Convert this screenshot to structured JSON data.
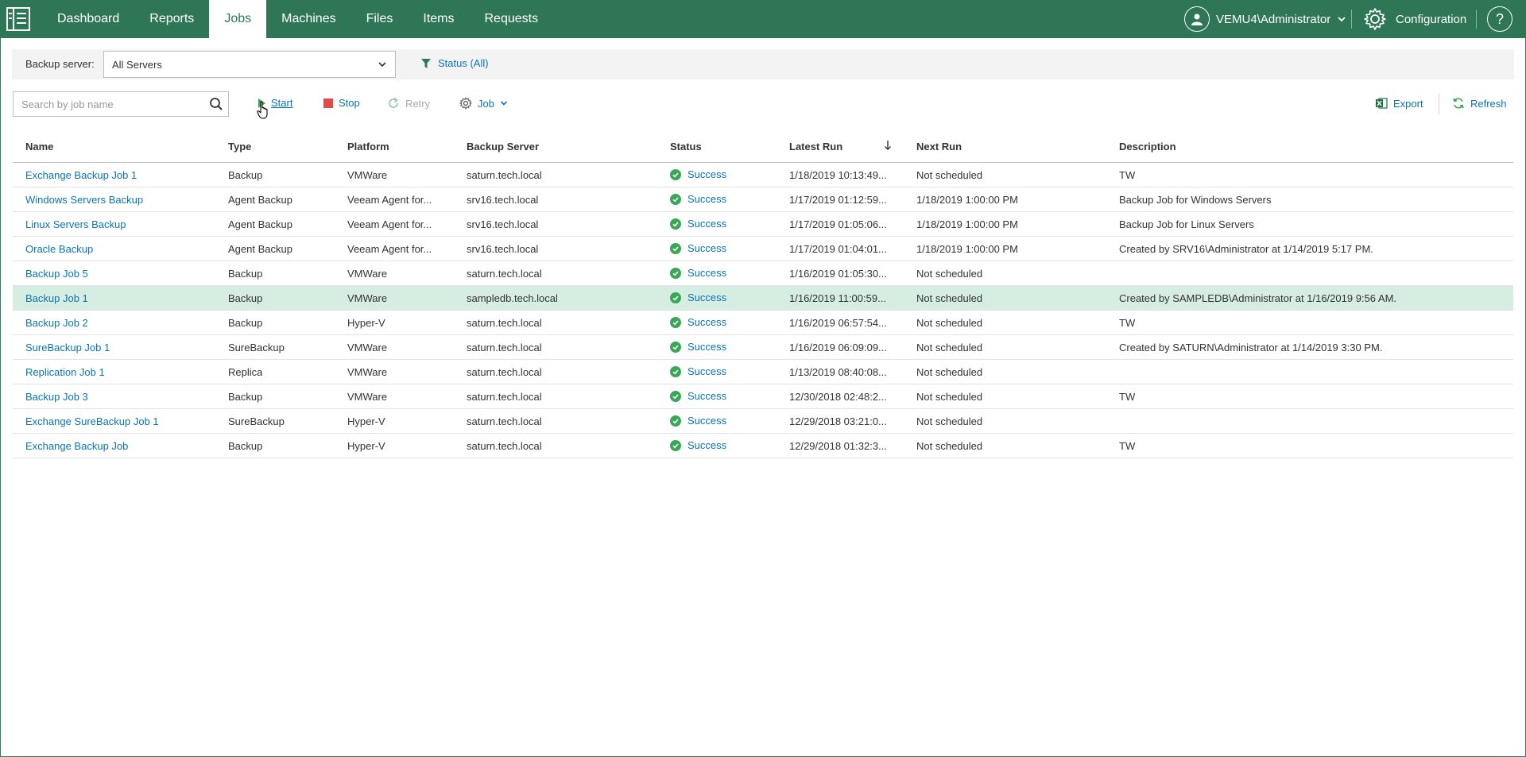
{
  "nav": {
    "tabs": [
      {
        "label": "Dashboard"
      },
      {
        "label": "Reports"
      },
      {
        "label": "Jobs"
      },
      {
        "label": "Machines"
      },
      {
        "label": "Files"
      },
      {
        "label": "Items"
      },
      {
        "label": "Requests"
      }
    ],
    "active_tab": "Jobs",
    "user": "VEMU4\\Administrator",
    "configuration": "Configuration",
    "help": "?"
  },
  "filter": {
    "backup_server_label": "Backup server:",
    "backup_server_value": "All Servers",
    "status_filter": "Status (All)"
  },
  "toolbar": {
    "search_placeholder": "Search by job name",
    "start": "Start",
    "stop": "Stop",
    "retry": "Retry",
    "job": "Job",
    "export": "Export",
    "refresh": "Refresh"
  },
  "table": {
    "columns": [
      "Name",
      "Type",
      "Platform",
      "Backup Server",
      "Status",
      "Latest Run",
      "Next Run",
      "Description"
    ],
    "rows": [
      {
        "name": "Exchange Backup Job 1",
        "type": "Backup",
        "platform": "VMWare",
        "server": "saturn.tech.local",
        "status": "Success",
        "latest": "1/18/2019 10:13:49...",
        "next": "Not scheduled",
        "description": "TW"
      },
      {
        "name": "Windows Servers Backup",
        "type": "Agent Backup",
        "platform": "Veeam Agent for...",
        "server": "srv16.tech.local",
        "status": "Success",
        "latest": "1/17/2019 01:12:59...",
        "next": "1/18/2019 1:00:00 PM",
        "description": "Backup Job for Windows Servers"
      },
      {
        "name": "Linux Servers Backup",
        "type": "Agent Backup",
        "platform": "Veeam Agent for...",
        "server": "srv16.tech.local",
        "status": "Success",
        "latest": "1/17/2019 01:05:06...",
        "next": "1/18/2019 1:00:00 PM",
        "description": "Backup Job for Linux Servers"
      },
      {
        "name": "Oracle Backup",
        "type": "Agent Backup",
        "platform": "Veeam Agent for...",
        "server": "srv16.tech.local",
        "status": "Success",
        "latest": "1/17/2019 01:04:01...",
        "next": "1/18/2019 1:00:00 PM",
        "description": "Created by SRV16\\Administrator at 1/14/2019 5:17 PM."
      },
      {
        "name": "Backup Job 5",
        "type": "Backup",
        "platform": "VMWare",
        "server": "saturn.tech.local",
        "status": "Success",
        "latest": "1/16/2019 01:05:30...",
        "next": "Not scheduled",
        "description": ""
      },
      {
        "name": "Backup Job 1",
        "type": "Backup",
        "platform": "VMWare",
        "server": "sampledb.tech.local",
        "status": "Success",
        "latest": "1/16/2019 11:00:59...",
        "next": "Not scheduled",
        "description": "Created by SAMPLEDB\\Administrator at 1/16/2019 9:56 AM.",
        "selected": true
      },
      {
        "name": "Backup Job 2",
        "type": "Backup",
        "platform": "Hyper-V",
        "server": "saturn.tech.local",
        "status": "Success",
        "latest": "1/16/2019 06:57:54...",
        "next": "Not scheduled",
        "description": "TW"
      },
      {
        "name": "SureBackup Job 1",
        "type": "SureBackup",
        "platform": "VMWare",
        "server": "saturn.tech.local",
        "status": "Success",
        "latest": "1/16/2019 06:09:09...",
        "next": "Not scheduled",
        "description": "Created by SATURN\\Administrator at 1/14/2019 3:30 PM."
      },
      {
        "name": "Replication Job 1",
        "type": "Replica",
        "platform": "VMWare",
        "server": "saturn.tech.local",
        "status": "Success",
        "latest": "1/13/2019 08:40:08...",
        "next": "Not scheduled",
        "description": ""
      },
      {
        "name": "Backup Job 3",
        "type": "Backup",
        "platform": "VMWare",
        "server": "saturn.tech.local",
        "status": "Success",
        "latest": "12/30/2018 02:48:2...",
        "next": "Not scheduled",
        "description": "TW"
      },
      {
        "name": "Exchange SureBackup Job 1",
        "type": "SureBackup",
        "platform": "Hyper-V",
        "server": "saturn.tech.local",
        "status": "Success",
        "latest": "12/29/2018 03:21:0...",
        "next": "Not scheduled",
        "description": ""
      },
      {
        "name": "Exchange Backup Job",
        "type": "Backup",
        "platform": "Hyper-V",
        "server": "saturn.tech.local",
        "status": "Success",
        "latest": "12/29/2018 01:32:3...",
        "next": "Not scheduled",
        "description": "TW"
      }
    ]
  },
  "colors": {
    "brand": "#2f7657",
    "link": "#0a74b3",
    "success": "#3aa757",
    "selected_row": "#d6ede2",
    "stop": "#e34b4b",
    "excel": "#1e7145"
  }
}
